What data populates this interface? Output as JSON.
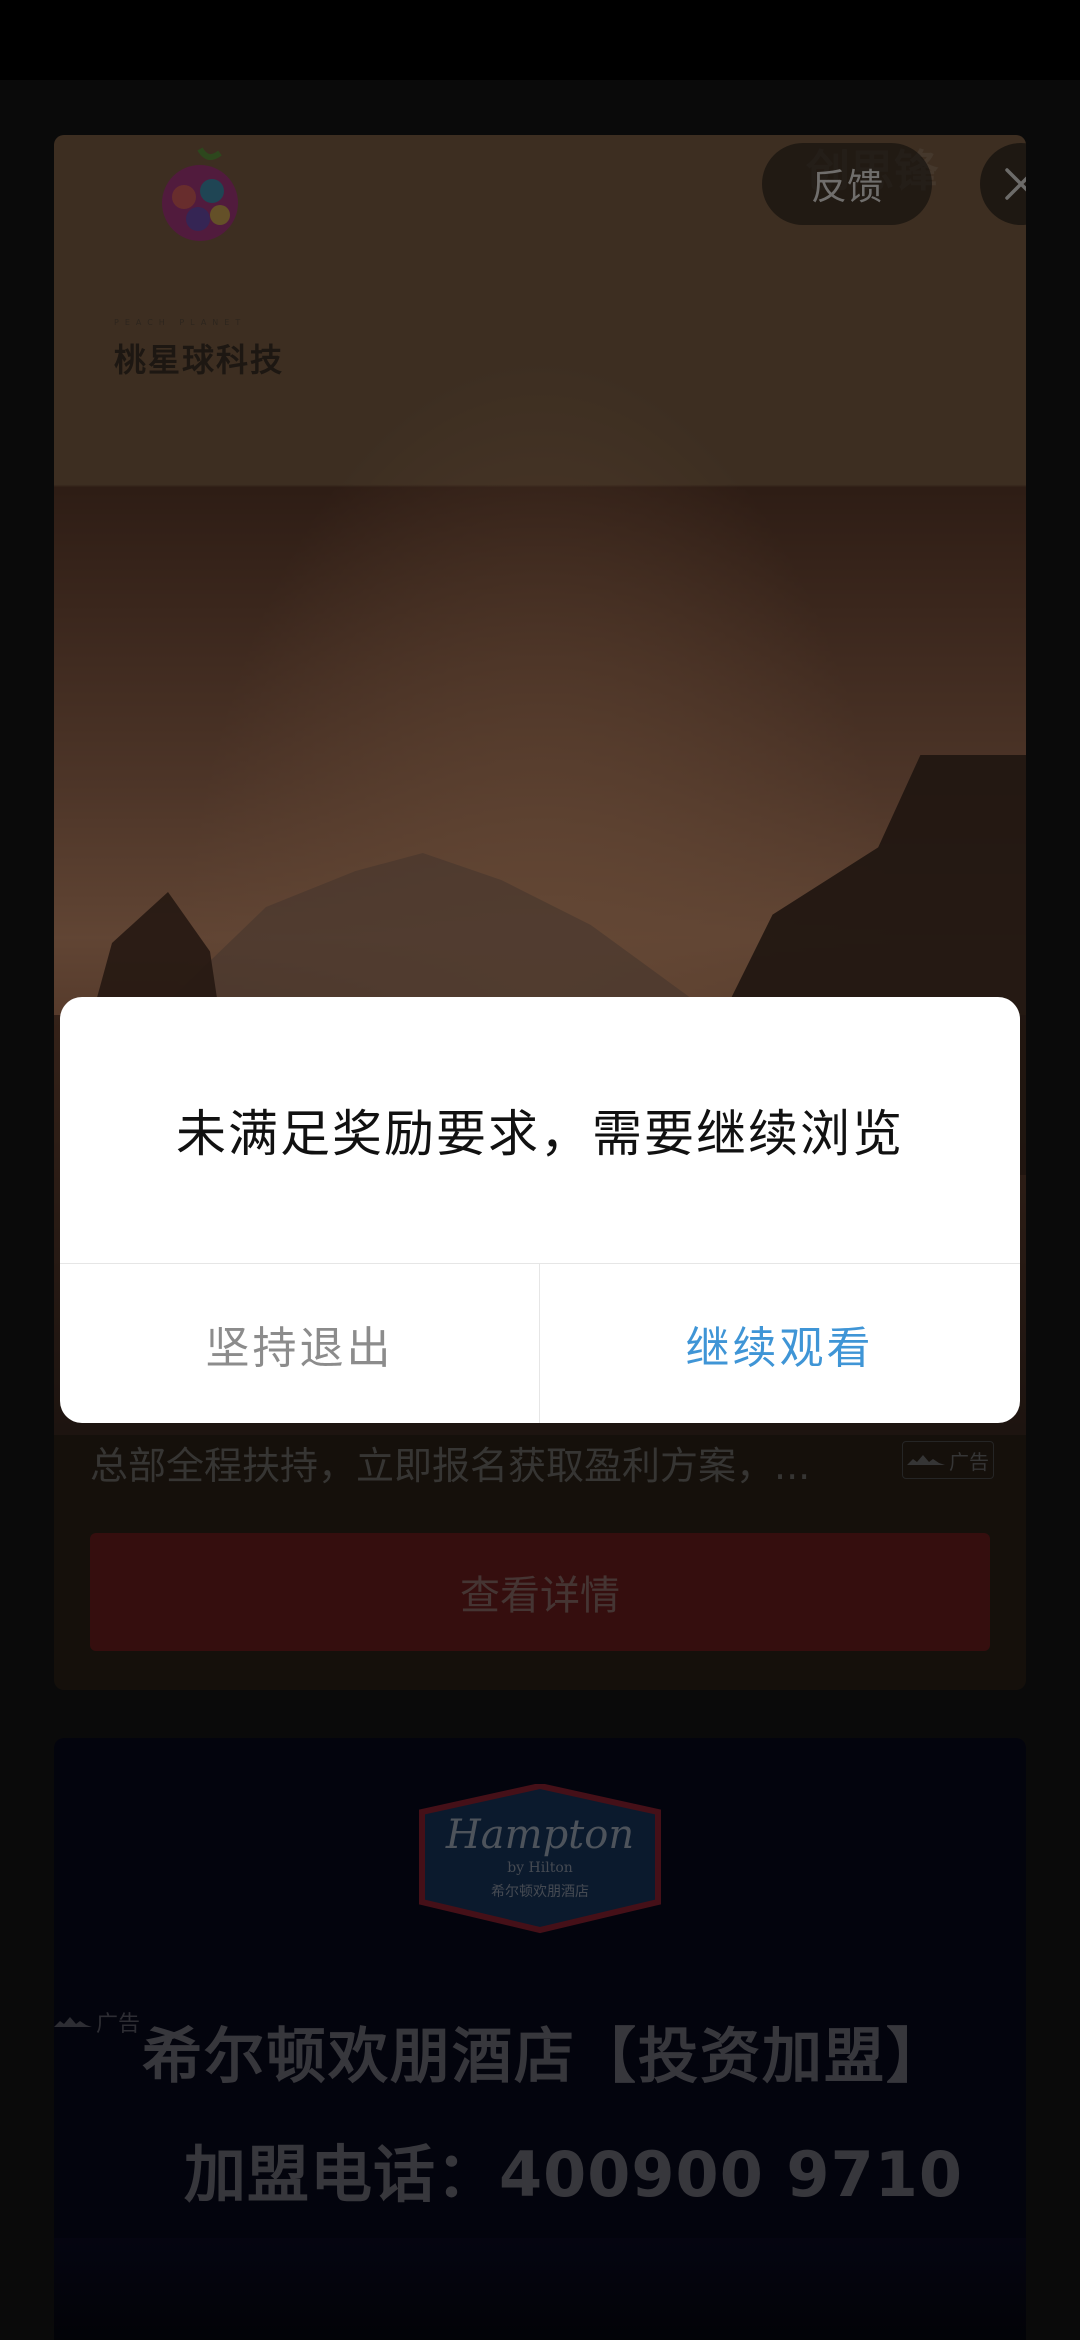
{
  "ad1": {
    "brand_name": "桃星球科技",
    "brand_tagline": "PEACH PLANET",
    "watermark": "创思锋",
    "feedback_label": "反馈",
    "description": "总部全程扶持，立即报名获取盈利方案，...",
    "badge_label": "广告",
    "cta_label": "查看详情"
  },
  "ad2": {
    "logo_text": "Hampton",
    "logo_sub": "by Hilton",
    "logo_cn": "希尔顿欢朋酒店",
    "badge_label": "广告",
    "headline": "希尔顿欢朋酒店【投资加盟】",
    "phone_line": "加盟电话：400900 9710"
  },
  "dialog": {
    "message": "未满足奖励要求，需要继续浏览",
    "exit_label": "坚持退出",
    "continue_label": "继续观看"
  },
  "colors": {
    "accent_blue": "#3f95d6",
    "cta_red": "#6b1c1c"
  }
}
